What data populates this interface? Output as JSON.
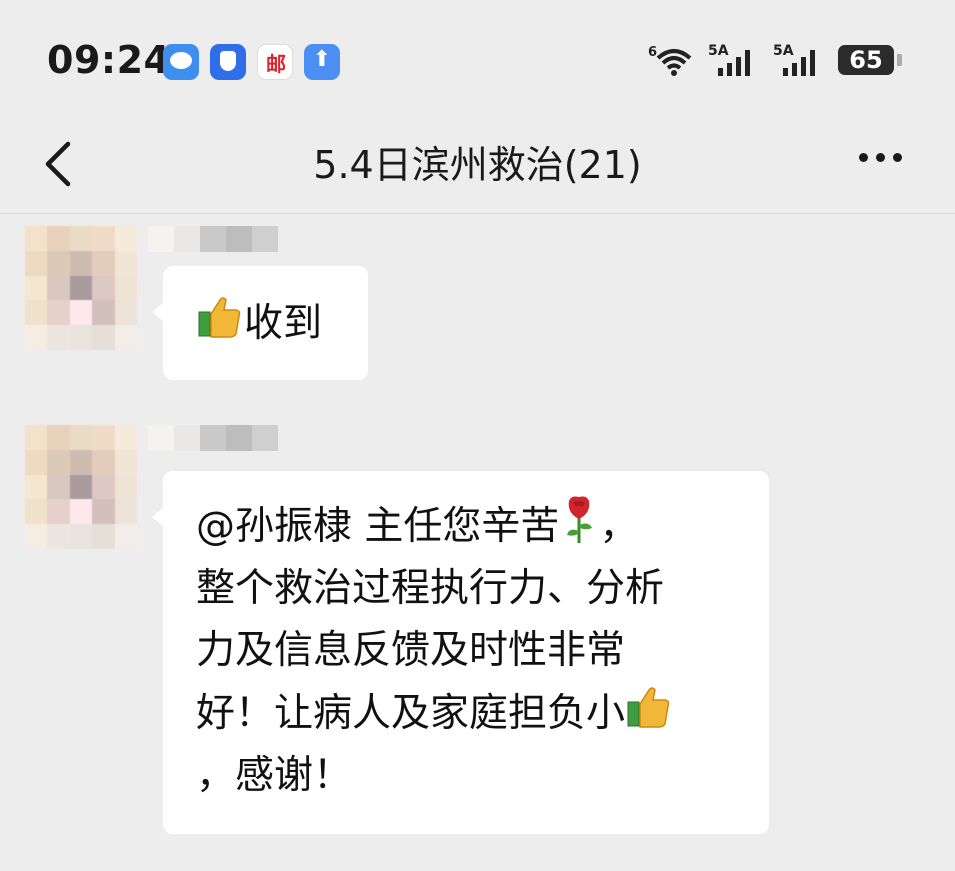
{
  "status_bar": {
    "time": "09:24",
    "notification_icons": [
      "chat-icon",
      "shield-icon",
      "mail-icon",
      "upload-icon"
    ],
    "mail_glyph": "邮",
    "upload_glyph": "⬆",
    "wifi_badge": "6",
    "signal_1_label": "5A",
    "signal_2_label": "5A",
    "battery": "65"
  },
  "header": {
    "title": "5.4日滨州救治(21)"
  },
  "messages": [
    {
      "text_lines": [
        "收到"
      ],
      "emoji": [
        "thumbs-up-icon"
      ]
    },
    {
      "text_lines": [
        "@孙振棣 主任您辛苦",
        "，",
        "整个救治过程执行力、分析",
        "力及信息反馈及时性非常",
        "好！让病人及家庭担负小",
        "，感谢！"
      ],
      "emoji": [
        "rose-icon",
        "thumbs-up-icon"
      ]
    }
  ],
  "colors": {
    "background": "#ededed",
    "bubble": "#ffffff",
    "title": "#1a1a1a"
  }
}
